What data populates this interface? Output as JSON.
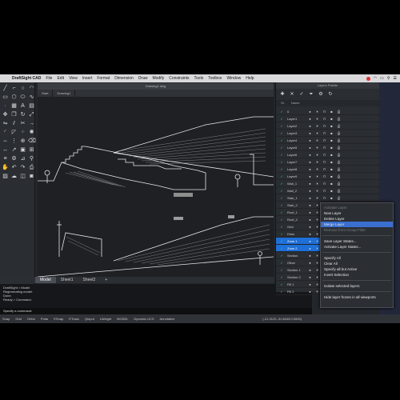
{
  "menubar": {
    "app_name": "DraftSight CAD",
    "items": [
      "File",
      "Edit",
      "View",
      "Insert",
      "Format",
      "Dimension",
      "Draw",
      "Modify",
      "Constraints",
      "Tools",
      "Toolbox",
      "Window",
      "Help"
    ]
  },
  "document": {
    "title": "Drawing1.dwg",
    "tabs": [
      "Start",
      "Drawing1"
    ]
  },
  "layout_tabs": [
    "Model",
    "Sheet1",
    "Sheet2",
    "+"
  ],
  "command": {
    "history": [
      "DraftSight > Model",
      "Regenerating model.",
      "Done.",
      "Ready > Command."
    ],
    "input": "Specify a command:"
  },
  "statusbar": {
    "items": [
      "Snap",
      "Grid",
      "Ortho",
      "Polar",
      "ESnap",
      "ETrack",
      "QInput",
      "LWeight",
      "MODEL",
      "Dynamic UCS",
      "Annotative"
    ],
    "coords": "(-21.3122,-31.8049,0.0000)"
  },
  "palette": {
    "title": "Layers Palette",
    "header": [
      "St.",
      "Name"
    ],
    "layers": [
      {
        "name": "0",
        "selected": false
      },
      {
        "name": "Layer1",
        "selected": false
      },
      {
        "name": "Layer2",
        "selected": false
      },
      {
        "name": "Layer3",
        "selected": false
      },
      {
        "name": "Layer4",
        "selected": false
      },
      {
        "name": "Layer5",
        "selected": false
      },
      {
        "name": "Layer6",
        "selected": false
      },
      {
        "name": "Layer7",
        "selected": false
      },
      {
        "name": "Layer8",
        "selected": false
      },
      {
        "name": "Layer9",
        "selected": false
      },
      {
        "name": "Wall_1",
        "selected": false
      },
      {
        "name": "Wall_2",
        "selected": false
      },
      {
        "name": "Stair_1",
        "selected": false
      },
      {
        "name": "Stair_2",
        "selected": false
      },
      {
        "name": "Roof_1",
        "selected": false
      },
      {
        "name": "Roof_2",
        "selected": false
      },
      {
        "name": "Grid",
        "selected": false
      },
      {
        "name": "Dims",
        "selected": false
      },
      {
        "name": "Zone 1",
        "selected": true
      },
      {
        "name": "Zone 2",
        "selected": true
      },
      {
        "name": "Section",
        "selected": false
      },
      {
        "name": "Other",
        "selected": false
      },
      {
        "name": "Section 1",
        "selected": false
      },
      {
        "name": "Section 2",
        "selected": false
      },
      {
        "name": "Fill 1",
        "selected": false
      },
      {
        "name": "Fill 2",
        "selected": false
      }
    ]
  },
  "context_menu": {
    "items": [
      {
        "label": "Activate Layer",
        "disabled": true
      },
      {
        "label": "New Layer",
        "disabled": false
      },
      {
        "label": "Delete Layer",
        "disabled": false
      },
      {
        "label": "Merge Layer",
        "disabled": false,
        "highlight": true
      },
      {
        "label": "Remove from Group Filter",
        "disabled": true
      },
      {
        "sep": true
      },
      {
        "label": "Save Layer States...",
        "disabled": false
      },
      {
        "label": "Activate Layer States...",
        "disabled": false
      },
      {
        "sep": true
      },
      {
        "label": "Specify All",
        "disabled": false
      },
      {
        "label": "Clear All",
        "disabled": false
      },
      {
        "label": "Specify all but Active",
        "disabled": false
      },
      {
        "label": "Invert Selection",
        "disabled": false
      },
      {
        "sep": true
      },
      {
        "label": "Isolate selected layers",
        "disabled": false
      },
      {
        "sep": true
      },
      {
        "label": "Hide layer frozen in all viewports",
        "disabled": false
      }
    ]
  },
  "colors": {
    "accent": "#1f6fd8",
    "background": "#23262b"
  }
}
